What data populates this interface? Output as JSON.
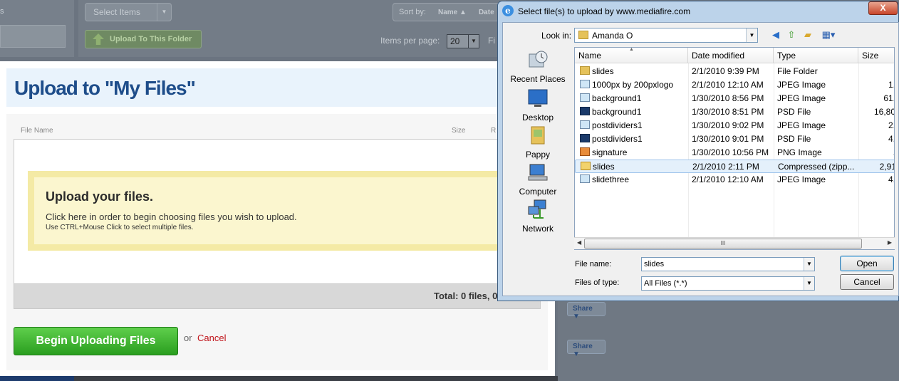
{
  "background": {
    "left_fragment": "s",
    "select_items": "Select Items",
    "sort_by": "Sort by:",
    "sort_name": "Name ▲",
    "sort_date": "Date",
    "upload_button": "Upload To This Folder",
    "items_per_page_label": "Items per page:",
    "items_per_page_value": "20",
    "right_fragment": "Fi",
    "share_label": "Share ▼"
  },
  "upload_dialog": {
    "title": "Upload to \"My Files\"",
    "col_file_name": "File Name",
    "col_size": "Size",
    "col_cut": "R",
    "drop_heading": "Upload your files.",
    "drop_line1": "Click here in order to begin choosing files you wish to upload.",
    "drop_line2": "Use CTRL+Mouse Click to select multiple files.",
    "total": "Total: 0 files, 0",
    "begin_button": "Begin Uploading Files",
    "or": "or",
    "cancel": "Cancel"
  },
  "file_dialog": {
    "title": "Select file(s) to upload by www.mediafire.com",
    "close": "X",
    "look_in_label": "Look in:",
    "look_in_value": "Amanda O",
    "places": [
      "Recent Places",
      "Desktop",
      "Pappy",
      "Computer",
      "Network"
    ],
    "columns": [
      "Name",
      "Date modified",
      "Type",
      "Size"
    ],
    "files": [
      {
        "name": "slides",
        "date": "2/1/2010 9:39 PM",
        "type": "File Folder",
        "size": "",
        "icon": "folder-icon"
      },
      {
        "name": "1000px by 200pxlogo",
        "date": "2/1/2010 12:10 AM",
        "type": "JPEG Image",
        "size": "1.",
        "icon": "jpeg-icon"
      },
      {
        "name": "background1",
        "date": "1/30/2010 8:56 PM",
        "type": "JPEG Image",
        "size": "61.",
        "icon": "jpeg-icon"
      },
      {
        "name": "background1",
        "date": "1/30/2010 8:51 PM",
        "type": "PSD File",
        "size": "16,80",
        "icon": "psd-icon"
      },
      {
        "name": "postdividers1",
        "date": "1/30/2010 9:02 PM",
        "type": "JPEG Image",
        "size": "2.",
        "icon": "jpeg-icon"
      },
      {
        "name": "postdividers1",
        "date": "1/30/2010 9:01 PM",
        "type": "PSD File",
        "size": "4.",
        "icon": "psd-icon"
      },
      {
        "name": "signature",
        "date": "1/30/2010 10:56 PM",
        "type": "PNG Image",
        "size": ".",
        "icon": "png-icon"
      },
      {
        "name": "slides",
        "date": "2/1/2010 2:11 PM",
        "type": "Compressed (zipp...",
        "size": "2,91",
        "icon": "zip-folder-icon",
        "selected": true
      },
      {
        "name": "slidethree",
        "date": "2/1/2010 12:10 AM",
        "type": "JPEG Image",
        "size": "4.",
        "icon": "jpeg-icon"
      }
    ],
    "scroll_grip": "III",
    "file_name_label": "File name:",
    "file_name_value": "slides",
    "file_type_label": "Files of type:",
    "file_type_value": "All Files (*.*)",
    "open_button": "Open",
    "cancel_button": "Cancel"
  }
}
